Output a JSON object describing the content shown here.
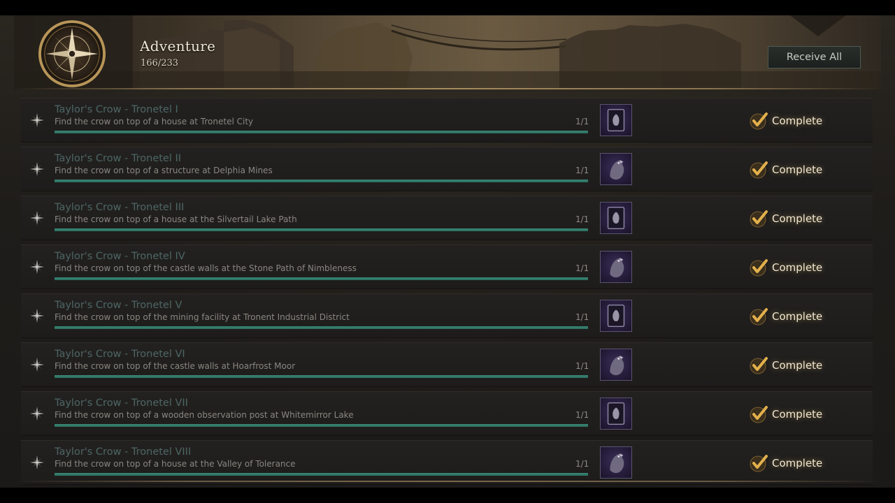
{
  "header": {
    "title": "Adventure",
    "progress": "166/233",
    "receive_all_label": "Receive All",
    "emblem_icon": "compass-icon"
  },
  "colors": {
    "quest_name": "#4c6664",
    "progress_fill": "#2f7a68",
    "complete_check": "#d9a441"
  },
  "quests": [
    {
      "name": "Taylor's Crow - Tronetel I",
      "desc": "Find the crow on top of a house at Tronetel City",
      "count": "1/1",
      "progress": 1,
      "status": "Complete",
      "reward_icon": "card-icon"
    },
    {
      "name": "Taylor's Crow - Tronetel II",
      "desc": "Find the crow on top of a structure at Delphia Mines",
      "count": "1/1",
      "progress": 1,
      "status": "Complete",
      "reward_icon": "crow-icon"
    },
    {
      "name": "Taylor's Crow - Tronetel III",
      "desc": "Find the crow on top of a house at the Silvertail Lake Path",
      "count": "1/1",
      "progress": 1,
      "status": "Complete",
      "reward_icon": "card-icon"
    },
    {
      "name": "Taylor's Crow - Tronetel IV",
      "desc": "Find the crow on top of the castle walls at the Stone Path of Nimbleness",
      "count": "1/1",
      "progress": 1,
      "status": "Complete",
      "reward_icon": "crow-icon"
    },
    {
      "name": "Taylor's Crow - Tronetel V",
      "desc": "Find the crow on top of the mining facility at Tronent Industrial District",
      "count": "1/1",
      "progress": 1,
      "status": "Complete",
      "reward_icon": "card-icon"
    },
    {
      "name": "Taylor's Crow - Tronetel VI",
      "desc": "Find the crow on top of the castle walls at Hoarfrost Moor",
      "count": "1/1",
      "progress": 1,
      "status": "Complete",
      "reward_icon": "crow-icon"
    },
    {
      "name": "Taylor's Crow - Tronetel VII",
      "desc": "Find the crow on top of a wooden observation post at Whitemirror Lake",
      "count": "1/1",
      "progress": 1,
      "status": "Complete",
      "reward_icon": "card-icon"
    },
    {
      "name": "Taylor's Crow - Tronetel VIII",
      "desc": "Find the crow on top of a house at the Valley of Tolerance",
      "count": "1/1",
      "progress": 1,
      "status": "Complete",
      "reward_icon": "crow-icon"
    }
  ]
}
